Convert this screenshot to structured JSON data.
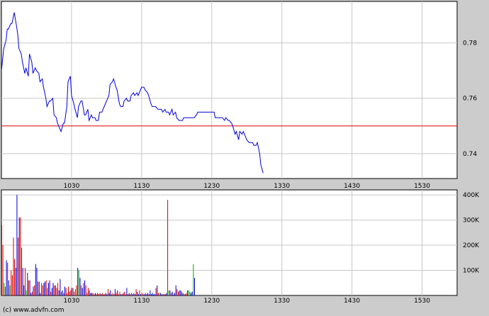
{
  "copyright": "(c) www.advfn.com",
  "colors": {
    "background": "#cccccc",
    "plot_background": "#ffffff",
    "grid": "#c8c8c8",
    "price_line": "#0000dd",
    "reference_line": "#dd0000",
    "volume_up": "#00aa00",
    "volume_down": "#dd0000",
    "volume_neutral": "#0000dd"
  },
  "chart_data": [
    {
      "type": "line",
      "name": "price",
      "x_ticks": [
        "1030",
        "1130",
        "1230",
        "1330",
        "1430",
        "1530"
      ],
      "x_range_minutes": [
        570,
        960
      ],
      "y_ticks": [
        "0.78",
        "0.76",
        "0.74"
      ],
      "ylim": [
        0.731,
        0.795
      ],
      "reference_value": 0.75,
      "x": [
        570,
        572,
        574,
        575,
        576,
        578,
        579,
        580,
        581,
        583,
        584,
        585,
        587,
        588,
        590,
        591,
        593,
        594,
        596,
        597,
        599,
        600,
        602,
        603,
        605,
        606,
        608,
        609,
        611,
        612,
        614,
        615,
        617,
        618,
        620,
        621,
        623,
        624,
        626,
        627,
        629,
        630,
        632,
        633,
        635,
        636,
        638,
        639,
        641,
        642,
        644,
        645,
        647,
        648,
        650,
        651,
        653,
        654,
        656,
        657,
        659,
        660,
        662,
        663,
        665,
        666,
        668,
        669,
        671,
        672,
        674,
        675,
        677,
        678,
        680,
        681,
        683,
        684,
        686,
        687,
        689,
        690,
        692,
        693,
        695,
        696,
        698,
        699,
        701,
        702,
        704,
        705,
        707,
        708,
        710,
        711,
        713,
        714,
        716,
        717,
        719,
        720,
        722,
        723,
        725,
        726,
        728,
        729,
        731,
        732,
        734,
        735,
        737,
        738,
        740,
        741,
        743,
        744,
        746,
        747,
        749,
        750,
        752,
        753,
        755,
        756,
        758,
        759,
        761,
        762,
        764,
        765,
        767,
        768,
        770,
        771,
        773,
        774,
        776,
        777,
        779,
        780,
        782,
        783,
        785,
        786,
        788,
        789,
        791,
        792,
        794
      ],
      "y": [
        0.77,
        0.778,
        0.781,
        0.785,
        0.785,
        0.787,
        0.787,
        0.789,
        0.791,
        0.786,
        0.783,
        0.778,
        0.776,
        0.773,
        0.769,
        0.771,
        0.768,
        0.776,
        0.773,
        0.769,
        0.771,
        0.77,
        0.769,
        0.766,
        0.767,
        0.764,
        0.76,
        0.757,
        0.759,
        0.759,
        0.76,
        0.754,
        0.753,
        0.751,
        0.749,
        0.748,
        0.751,
        0.751,
        0.757,
        0.766,
        0.768,
        0.761,
        0.758,
        0.756,
        0.753,
        0.757,
        0.759,
        0.759,
        0.754,
        0.754,
        0.756,
        0.752,
        0.754,
        0.753,
        0.753,
        0.752,
        0.752,
        0.755,
        0.755,
        0.756,
        0.758,
        0.759,
        0.761,
        0.765,
        0.766,
        0.767,
        0.764,
        0.763,
        0.758,
        0.757,
        0.757,
        0.759,
        0.76,
        0.759,
        0.759,
        0.761,
        0.762,
        0.761,
        0.762,
        0.761,
        0.763,
        0.764,
        0.764,
        0.763,
        0.762,
        0.761,
        0.758,
        0.757,
        0.757,
        0.757,
        0.756,
        0.756,
        0.756,
        0.755,
        0.756,
        0.755,
        0.755,
        0.754,
        0.756,
        0.754,
        0.755,
        0.753,
        0.752,
        0.752,
        0.752,
        0.753,
        0.753,
        0.753,
        0.753,
        0.753,
        0.753,
        0.753,
        0.754,
        0.755,
        0.755,
        0.755,
        0.755,
        0.755,
        0.755,
        0.755,
        0.755,
        0.755,
        0.755,
        0.753,
        0.753,
        0.753,
        0.753,
        0.753,
        0.752,
        0.753,
        0.752,
        0.752,
        0.751,
        0.75,
        0.747,
        0.748,
        0.745,
        0.748,
        0.747,
        0.748,
        0.746,
        0.745,
        0.744,
        0.744,
        0.744,
        0.743,
        0.743,
        0.744,
        0.74,
        0.736,
        0.733
      ]
    },
    {
      "type": "bar",
      "name": "volume",
      "x_ticks": [
        "1030",
        "1130",
        "1230",
        "1330",
        "1430",
        "1530"
      ],
      "x_range_minutes": [
        570,
        960
      ],
      "y_ticks": [
        "400K",
        "300K",
        "200K",
        "100K"
      ],
      "ylim": [
        0,
        420000
      ],
      "x": [
        570,
        571,
        572,
        573,
        574,
        575,
        576,
        577,
        578,
        579,
        580,
        581,
        582,
        583,
        584,
        585,
        586,
        587,
        588,
        589,
        590,
        591,
        592,
        593,
        594,
        595,
        596,
        597,
        598,
        599,
        600,
        601,
        602,
        603,
        604,
        605,
        606,
        607,
        608,
        609,
        610,
        611,
        612,
        613,
        614,
        615,
        616,
        617,
        618,
        619,
        620,
        621,
        622,
        623,
        624,
        625,
        626,
        627,
        628,
        629,
        630,
        631,
        632,
        633,
        634,
        635,
        636,
        637,
        638,
        639,
        640,
        641,
        642,
        643,
        644,
        645,
        646,
        647,
        648,
        649,
        650,
        651,
        652,
        653,
        654,
        655,
        656,
        657,
        658,
        659,
        660,
        661,
        662,
        663,
        664,
        665,
        666,
        667,
        668,
        669,
        670,
        671,
        672,
        673,
        674,
        675,
        676,
        677,
        678,
        679,
        680,
        681,
        682,
        683,
        684,
        685,
        686,
        687,
        688,
        689,
        690,
        691,
        692,
        693,
        694,
        695,
        696,
        697,
        698,
        699,
        700,
        701,
        702,
        703,
        704,
        705,
        706,
        707,
        708,
        709,
        710,
        711,
        712,
        713,
        714,
        715,
        716,
        717,
        718,
        719,
        720,
        721,
        722,
        723,
        724,
        725,
        726,
        727,
        728,
        729,
        730,
        731,
        732,
        733,
        734,
        735,
        736,
        737,
        738,
        739,
        740,
        741,
        742,
        743,
        744,
        745,
        746,
        747,
        748,
        749,
        750,
        751,
        752,
        753,
        754,
        755,
        756,
        757,
        758,
        759,
        760,
        761,
        762,
        763,
        764,
        765,
        766,
        767,
        768,
        769,
        770,
        771,
        772,
        773,
        774,
        775,
        776,
        777,
        778,
        779,
        780,
        781,
        782,
        783,
        784,
        785,
        786,
        787,
        788,
        789,
        790,
        791,
        792,
        793,
        794
      ],
      "values": [
        280000,
        200000,
        50000,
        35000,
        140000,
        130000,
        60000,
        40000,
        100000,
        80000,
        230000,
        145000,
        110000,
        400000,
        230000,
        310000,
        310000,
        190000,
        110000,
        40000,
        110000,
        20000,
        90000,
        60000,
        60000,
        10000,
        15000,
        35000,
        40000,
        125000,
        110000,
        55000,
        55000,
        10000,
        50000,
        40000,
        50000,
        55000,
        60000,
        30000,
        50000,
        60000,
        15000,
        30000,
        50000,
        40000,
        40000,
        30000,
        50000,
        20000,
        65000,
        15000,
        20000,
        10000,
        35000,
        30000,
        10000,
        35000,
        15000,
        20000,
        30000,
        30000,
        15000,
        25000,
        40000,
        110000,
        100000,
        70000,
        40000,
        30000,
        50000,
        60000,
        40000,
        10000,
        30000,
        20000,
        10000,
        10000,
        10000,
        5000,
        10000,
        5000,
        10000,
        5000,
        10000,
        5000,
        10000,
        5000,
        5000,
        10000,
        5000,
        25000,
        10000,
        20000,
        5000,
        10000,
        5000,
        25000,
        10000,
        20000,
        5000,
        15000,
        5000,
        5000,
        10000,
        15000,
        5000,
        30000,
        5000,
        10000,
        5000,
        10000,
        5000,
        10000,
        5000,
        25000,
        15000,
        5000,
        20000,
        5000,
        10000,
        5000,
        5000,
        10000,
        5000,
        10000,
        5000,
        20000,
        5000,
        10000,
        5000,
        5000,
        30000,
        40000,
        10000,
        10000,
        10000,
        5000,
        5000,
        5000,
        5000,
        10000,
        380000,
        20000,
        20000,
        10000,
        15000,
        5000,
        10000,
        40000,
        25000,
        15000,
        20000,
        20000,
        15000,
        10000,
        5000,
        5000,
        10000,
        20000,
        20000,
        15000,
        10000,
        15000,
        125000,
        70000
      ],
      "colors": [
        "d",
        "d",
        "u",
        "d",
        "n",
        "d",
        "n",
        "u",
        "d",
        "d",
        "d",
        "d",
        "n",
        "n",
        "d",
        "n",
        "d",
        "d",
        "n",
        "n",
        "d",
        "u",
        "n",
        "d",
        "n",
        "n",
        "d",
        "n",
        "d",
        "n",
        "n",
        "d",
        "n",
        "n",
        "d",
        "d",
        "n",
        "n",
        "d",
        "d",
        "n",
        "n",
        "d",
        "n",
        "n",
        "d",
        "n",
        "d",
        "d",
        "n",
        "n",
        "d",
        "n",
        "d",
        "n",
        "d",
        "d",
        "d",
        "n",
        "d",
        "n",
        "d",
        "d",
        "u",
        "d",
        "n",
        "u",
        "n",
        "d",
        "n",
        "d",
        "n",
        "d",
        "d",
        "d",
        "n",
        "n",
        "n",
        "d",
        "d",
        "n",
        "d",
        "n",
        "d",
        "d",
        "n",
        "d",
        "n",
        "d",
        "n",
        "n",
        "d",
        "n",
        "n",
        "d",
        "d",
        "d",
        "n",
        "d",
        "n",
        "d",
        "d",
        "n",
        "d",
        "n",
        "d",
        "d",
        "n",
        "d",
        "n",
        "d",
        "d",
        "n",
        "d",
        "n",
        "d",
        "n",
        "n",
        "d",
        "n",
        "d",
        "d",
        "n",
        "d",
        "n",
        "n",
        "d",
        "n",
        "n",
        "n",
        "n",
        "n",
        "d",
        "n",
        "d",
        "u",
        "n",
        "d",
        "n",
        "d",
        "n",
        "n",
        "d",
        "u",
        "n",
        "d",
        "n",
        "d",
        "n",
        "n",
        "d",
        "d",
        "n",
        "n",
        "d",
        "n",
        "d",
        "n",
        "d",
        "n",
        "u",
        "u",
        "n",
        "n",
        "u",
        "n"
      ]
    }
  ]
}
